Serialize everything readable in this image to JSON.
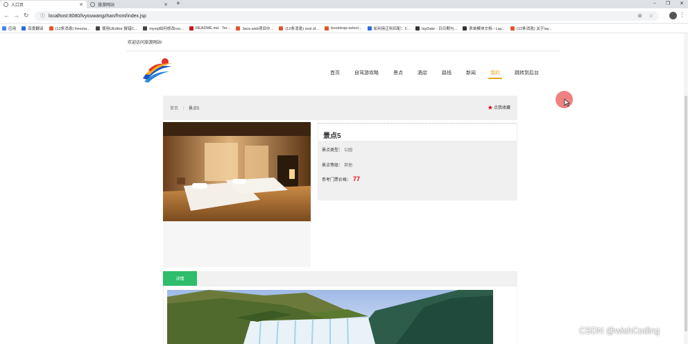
{
  "browser": {
    "tabs": [
      {
        "title": "入口页",
        "active": true
      },
      {
        "title": "旅游网站",
        "active": false
      }
    ],
    "new_tab": "+",
    "window_controls": [
      "−",
      "❐",
      "✕"
    ],
    "url": "localhost:8080/lvyouwangzhan/front/index.jsp",
    "bookmarks": [
      {
        "label": "应用",
        "color": "#4285f4"
      },
      {
        "label": "百度翻译",
        "color": "#2a6be0"
      },
      {
        "label": "(12条消息) freema...",
        "color": "#e2542b"
      },
      {
        "label": "使用UEditor 报错C...",
        "color": "#444444"
      },
      {
        "label": "mysql如何修改roo...",
        "color": "#444444"
      },
      {
        "label": "README.md · Ter...",
        "color": "#c7161d"
      },
      {
        "label": "Java web项目中...",
        "color": "#e2542b"
      },
      {
        "label": "(12条消息) root of...",
        "color": "#e2542b"
      },
      {
        "label": "bootstrap-select...",
        "color": "#e2542b"
      },
      {
        "label": "如何用正则匹配：2...",
        "color": "#2a6be0"
      },
      {
        "label": "layDate - 日日期与...",
        "color": "#333333"
      },
      {
        "label": "表单模块文档 - Lay...",
        "color": "#333333"
      },
      {
        "label": "(12条消息) 关于lay...",
        "color": "#e2542b"
      }
    ]
  },
  "header": {
    "welcome": "欢迎访问旅游网站!",
    "nav": [
      {
        "label": "首页",
        "active": false
      },
      {
        "label": "自驾游攻略",
        "active": false
      },
      {
        "label": "景点",
        "active": false
      },
      {
        "label": "酒店",
        "active": false
      },
      {
        "label": "路线",
        "active": false
      },
      {
        "label": "新闻",
        "active": false
      },
      {
        "label": "我的",
        "active": true
      },
      {
        "label": "跳转到后台",
        "active": false
      }
    ]
  },
  "breadcrumb": {
    "home": "首页",
    "separator": "/",
    "current": "景点5"
  },
  "favorite": {
    "label": "点我收藏",
    "star_color": "#e60012"
  },
  "attraction": {
    "title": "景点5",
    "type_label": "景点类型：",
    "type_value": "公园",
    "level_label": "景点等级：",
    "level_value": "其他",
    "price_label": "参考门票价格：",
    "price_value": "77"
  },
  "detail": {
    "tab_label": "详情"
  },
  "watermark": "CSDN @wishCoding",
  "colors": {
    "accent": "#e6a817",
    "green": "#2ebd6b",
    "price": "#e60012"
  }
}
